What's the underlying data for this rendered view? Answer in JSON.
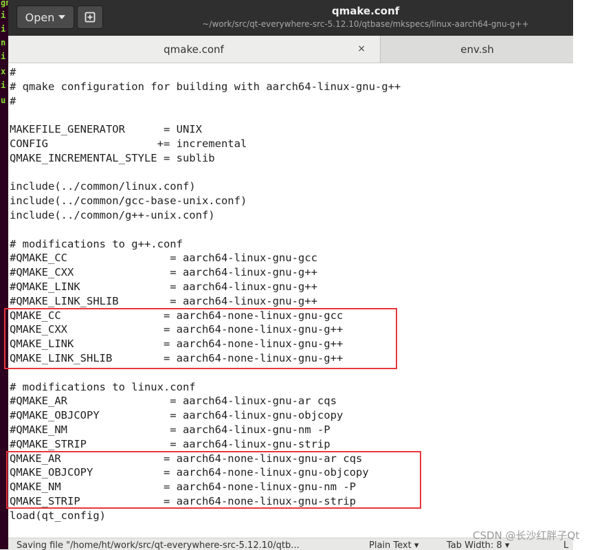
{
  "terminal_strip": [
    "gn",
    "i",
    "i",
    "n",
    "i",
    "x",
    "i",
    "u"
  ],
  "toolbar": {
    "open_label": "Open"
  },
  "window": {
    "title": "qmake.conf",
    "path": "~/work/src/qt-everywhere-src-5.12.10/qtbase/mkspecs/linux-aarch64-gnu-g++"
  },
  "tabs": [
    {
      "label": "qmake.conf",
      "close": "×"
    },
    {
      "label": "env.sh"
    }
  ],
  "editor": {
    "content": "#\n# qmake configuration for building with aarch64-linux-gnu-g++\n#\n\nMAKEFILE_GENERATOR      = UNIX\nCONFIG                 += incremental\nQMAKE_INCREMENTAL_STYLE = sublib\n\ninclude(../common/linux.conf)\ninclude(../common/gcc-base-unix.conf)\ninclude(../common/g++-unix.conf)\n\n# modifications to g++.conf\n#QMAKE_CC                = aarch64-linux-gnu-gcc\n#QMAKE_CXX               = aarch64-linux-gnu-g++\n#QMAKE_LINK              = aarch64-linux-gnu-g++\n#QMAKE_LINK_SHLIB        = aarch64-linux-gnu-g++\nQMAKE_CC                = aarch64-none-linux-gnu-gcc\nQMAKE_CXX               = aarch64-none-linux-gnu-g++\nQMAKE_LINK              = aarch64-none-linux-gnu-g++\nQMAKE_LINK_SHLIB        = aarch64-none-linux-gnu-g++\n\n# modifications to linux.conf\n#QMAKE_AR                = aarch64-linux-gnu-ar cqs\n#QMAKE_OBJCOPY           = aarch64-linux-gnu-objcopy\n#QMAKE_NM                = aarch64-linux-gnu-nm -P\n#QMAKE_STRIP             = aarch64-linux-gnu-strip\nQMAKE_AR                = aarch64-none-linux-gnu-ar cqs\nQMAKE_OBJCOPY           = aarch64-none-linux-gnu-objcopy\nQMAKE_NM                = aarch64-none-linux-gnu-nm -P\nQMAKE_STRIP             = aarch64-none-linux-gnu-strip\nload(qt_config)"
  },
  "statusbar": {
    "message": "Saving file \"/home/ht/work/src/qt-everywhere-src-5.12.10/qtb...",
    "language": "Plain Text ▾",
    "tab_width": "Tab Width: 8 ▾",
    "position": "L"
  },
  "watermark": "CSDN @长沙红胖子Qt",
  "colors": {
    "titlebar": "#2f2f2f",
    "highlight_box": "#e8363b",
    "terminal_bg": "#2c001e",
    "terminal_text": "#8ae234"
  }
}
